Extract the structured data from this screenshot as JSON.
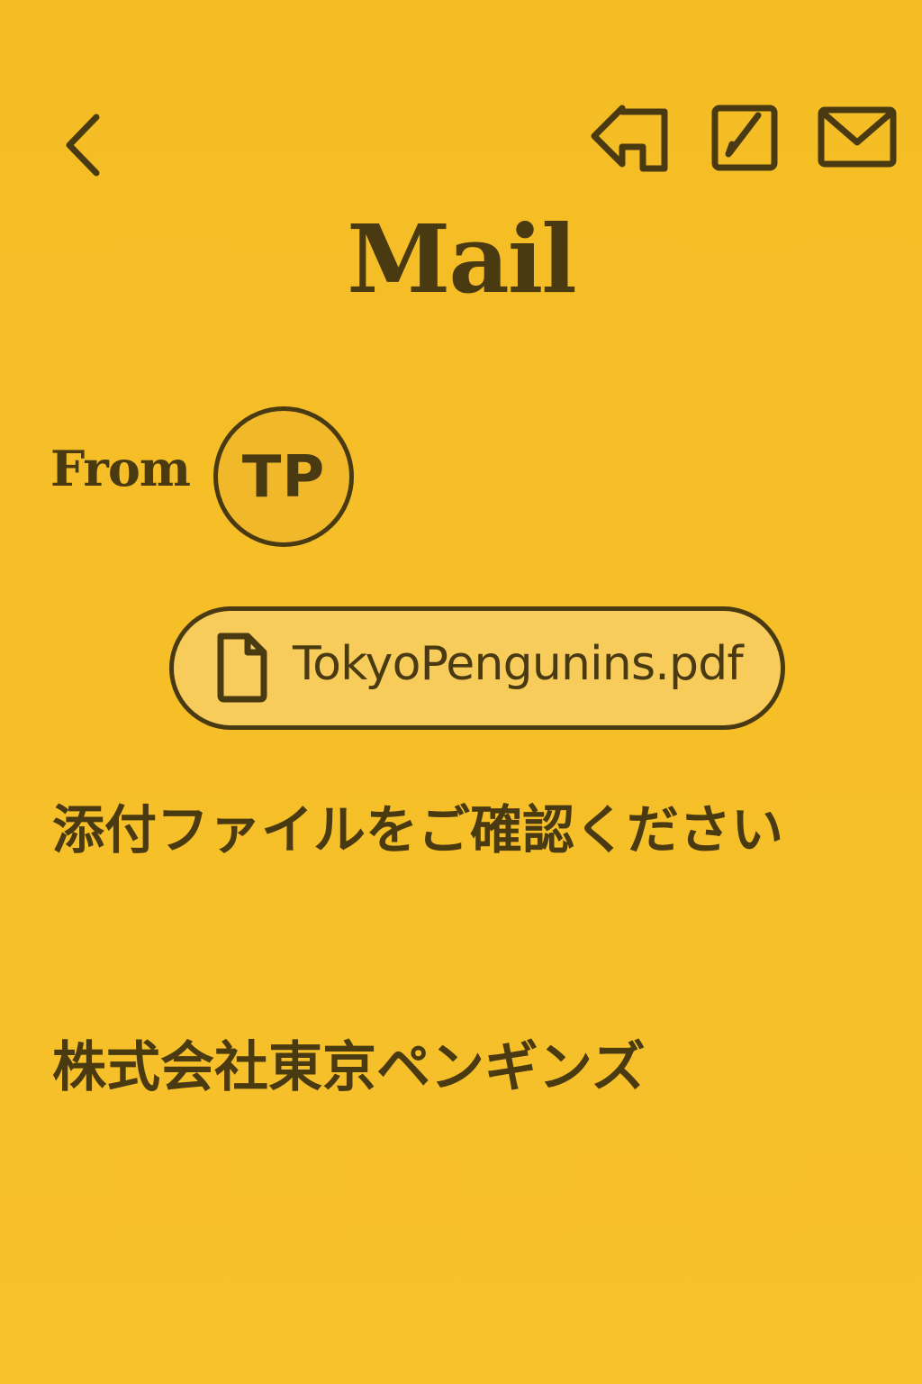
{
  "header": {
    "title": "Mail",
    "icons": {
      "back": "chevron-left-icon",
      "reply": "reply-icon",
      "compose": "compose-icon",
      "mail": "mail-icon"
    }
  },
  "message": {
    "from_label": "From",
    "sender_initials": "TP",
    "attachment": {
      "name": "TokyoPengunins.pdf",
      "icon": "file-icon"
    },
    "body": "添付ファイルをご確認ください",
    "signature": "株式会社東京ペンギンズ"
  },
  "colors": {
    "background": "#F6BF27",
    "text": "#4A3A12",
    "attachment_fill": "#F8CC5A"
  }
}
